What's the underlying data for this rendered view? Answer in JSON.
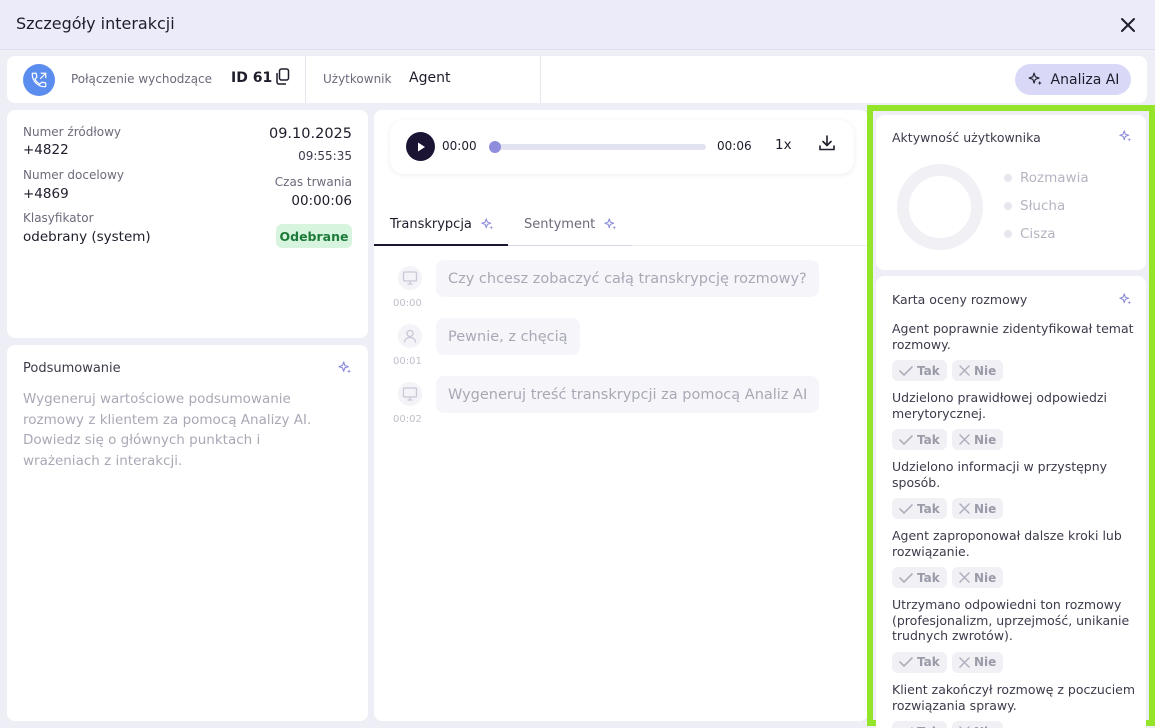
{
  "window": {
    "title": "Szczegóły interakcji"
  },
  "info": {
    "call_type_label": "Połączenie wychodzące",
    "id_label": "ID 61",
    "user_label": "Użytkownik",
    "user_value": "Agent",
    "ai_button": "Analiza AI"
  },
  "details": {
    "source_label": "Numer źródłowy",
    "source_value": "+4822",
    "target_label": "Numer docelowy",
    "target_value": "+4869",
    "classifier_label": "Klasyfikator",
    "classifier_value": "odebrany (system)",
    "date": "09.10.2025",
    "time": "09:55:35",
    "duration_label": "Czas trwania",
    "duration_value": "00:00:06",
    "status_badge": "Odebrane"
  },
  "summary": {
    "title": "Podsumowanie",
    "text": "Wygeneruj wartościowe podsumowanie rozmowy z klientem za pomocą Analizy AI. Dowiedz się o głównych punktach i wrażeniach z interakcji."
  },
  "player": {
    "current": "00:00",
    "total": "00:06",
    "speed": "1x",
    "progress": 0
  },
  "tabs": [
    {
      "label": "Transkrypcja",
      "active": true
    },
    {
      "label": "Sentyment",
      "active": false
    }
  ],
  "transcript": [
    {
      "speaker": "agent",
      "time": "00:00",
      "text": "Czy chcesz zobaczyć całą transkrypcję rozmowy?"
    },
    {
      "speaker": "client",
      "time": "00:01",
      "text": "Pewnie, z chęcią"
    },
    {
      "speaker": "agent",
      "time": "00:02",
      "text": "Wygeneruj treść transkrypcji za pomocą Analiz AI"
    }
  ],
  "activity": {
    "title": "Aktywność użytkownika",
    "legend": [
      "Rozmawia",
      "Słucha",
      "Cisza"
    ]
  },
  "scorecard": {
    "title": "Karta oceny rozmowy",
    "yes": "Tak",
    "no": "Nie",
    "questions": [
      "Agent poprawnie zidentyfikował temat rozmowy.",
      "Udzielono prawidłowej odpowiedzi merytorycznej.",
      "Udzielono informacji w przystępny sposób.",
      "Agent zaproponował dalsze kroki lub rozwiązanie.",
      "Utrzymano odpowiedni ton rozmowy (profesjonalizm, uprzejmość, unikanie trudnych zwrotów).",
      "Klient zakończył rozmowę z poczuciem rozwiązania sprawy."
    ]
  },
  "colors": {
    "accent": "#5b8def",
    "highlight": "#94e52a",
    "ai_button": "#d9d9f7",
    "badge_bg": "#d7f5de"
  }
}
